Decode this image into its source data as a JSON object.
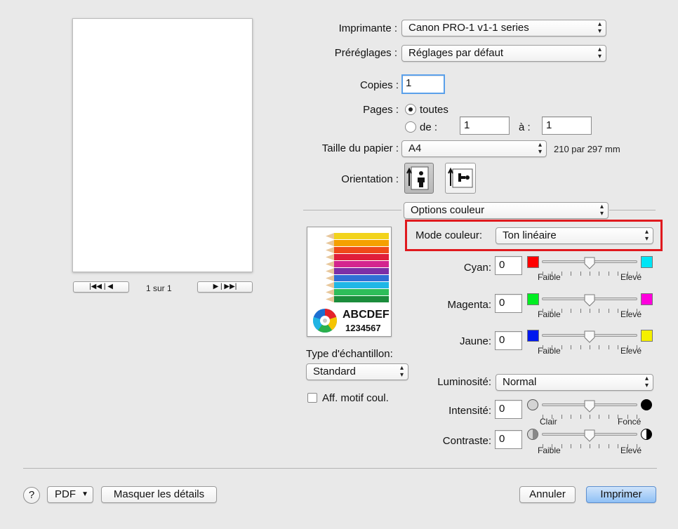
{
  "preview": {
    "nav_first_prev": "|◀◀ | ◀",
    "page_info": "1 sur 1",
    "nav_next_last": "▶ | ▶▶|"
  },
  "printer": {
    "label": "Imprimante :",
    "value": "Canon PRO-1 v1-1 series"
  },
  "presets": {
    "label": "Préréglages :",
    "value": "Réglages par défaut"
  },
  "copies": {
    "label": "Copies :",
    "value": "1"
  },
  "pages": {
    "label": "Pages :",
    "all_label": "toutes",
    "from_label": "de :",
    "from_value": "1",
    "to_label": "à :",
    "to_value": "1",
    "selected": "all"
  },
  "paper_size": {
    "label": "Taille du papier :",
    "value": "A4",
    "dimensions": "210 par 297 mm"
  },
  "orientation": {
    "label": "Orientation :",
    "selected": "portrait"
  },
  "section": {
    "value": "Options couleur"
  },
  "sample": {
    "abc_text": "ABCDEF",
    "num_text": "1234567",
    "type_label": "Type d'échantillon:",
    "type_value": "Standard",
    "pattern_label": "Aff. motif coul.",
    "pattern_checked": false
  },
  "color_mode": {
    "label": "Mode couleur:",
    "value": "Ton linéaire"
  },
  "sliders": {
    "cyan": {
      "label": "Cyan:",
      "value": "0",
      "min_label": "Faible",
      "max_label": "Elevé",
      "left_color": "#ff0000",
      "right_color": "#00e5f5",
      "level": 0.5
    },
    "magenta": {
      "label": "Magenta:",
      "value": "0",
      "min_label": "Faible",
      "max_label": "Elevé",
      "left_color": "#00ee22",
      "right_color": "#ff00dd",
      "level": 0.5
    },
    "yellow": {
      "label": "Jaune:",
      "value": "0",
      "min_label": "Faible",
      "max_label": "Elevé",
      "left_color": "#0018ee",
      "right_color": "#f5f000",
      "level": 0.5
    },
    "intensity": {
      "label": "Intensité:",
      "value": "0",
      "min_label": "Clair",
      "max_label": "Foncé",
      "level": 0.5
    },
    "contrast": {
      "label": "Contraste:",
      "value": "0",
      "min_label": "Faible",
      "max_label": "Elevé",
      "level": 0.5
    }
  },
  "brightness": {
    "label": "Luminosité:",
    "value": "Normal"
  },
  "footer": {
    "help": "?",
    "pdf": "PDF",
    "hide_details": "Masquer les détails",
    "cancel": "Annuler",
    "print": "Imprimer"
  },
  "colors": {
    "highlight": "#e0191e",
    "accent": "#5aa0ea"
  }
}
